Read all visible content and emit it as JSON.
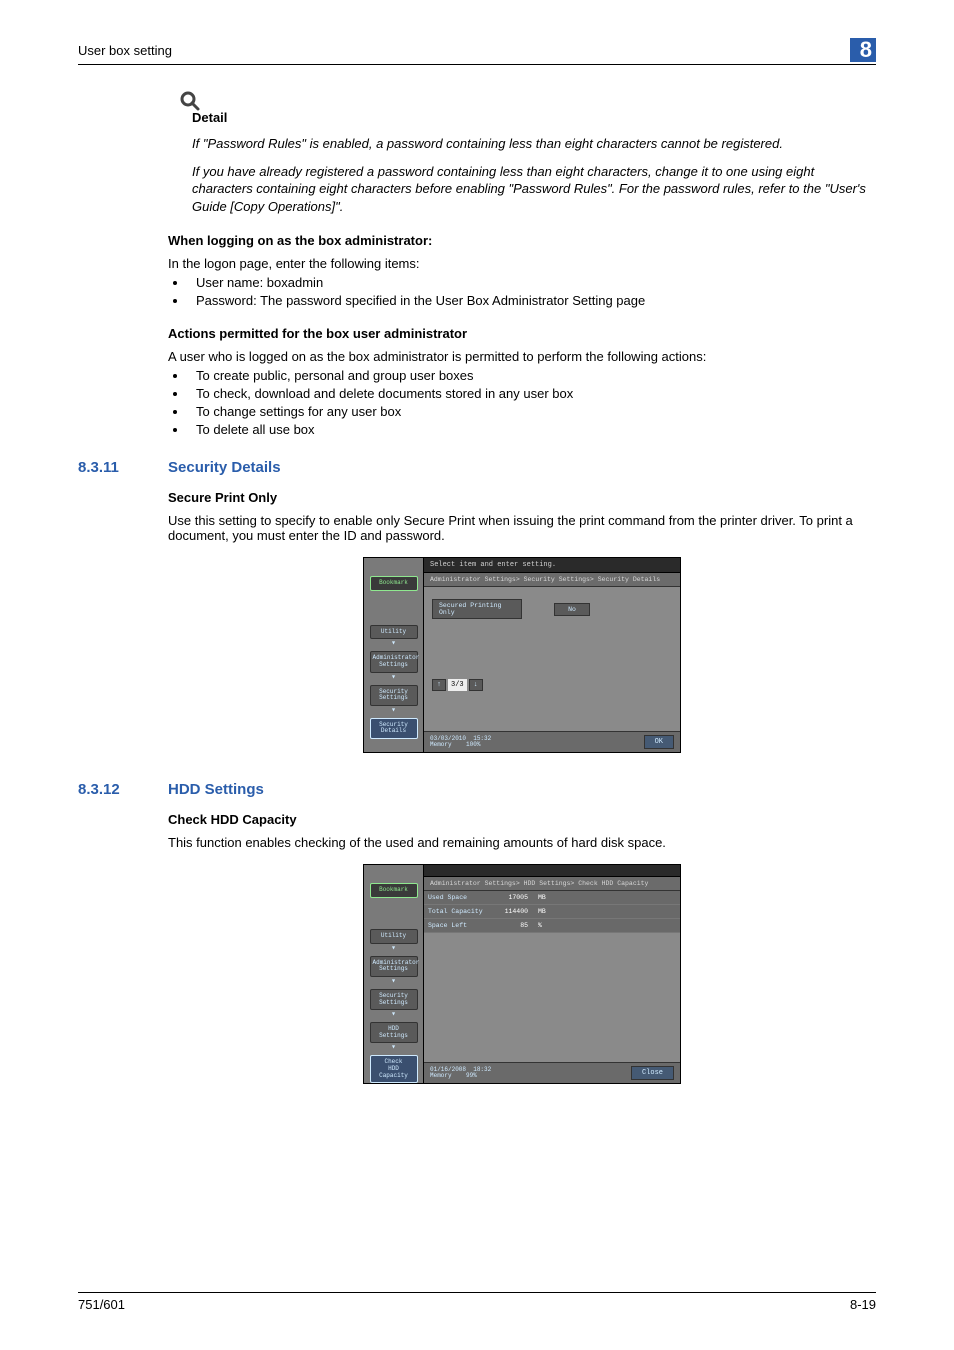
{
  "header": {
    "title": "User box setting",
    "chapter": "8"
  },
  "detail": {
    "label": "Detail",
    "p1": "If \"Password Rules\" is enabled, a password containing less than eight characters cannot be registered.",
    "p2": "If you have already registered a password containing less than eight characters, change it to one using eight characters containing eight characters before enabling \"Password Rules\". For the password rules, refer to the \"User's Guide [Copy Operations]\"."
  },
  "login": {
    "heading": "When logging on as the box administrator:",
    "intro": "In the logon page, enter the following items:",
    "items": [
      "User name: boxadmin",
      "Password: The password specified in the User Box Administrator Setting page"
    ]
  },
  "actions": {
    "heading": "Actions permitted for the box user administrator",
    "intro": "A user who is logged on as the box administrator is permitted to perform the following actions:",
    "items": [
      "To create public, personal and group user boxes",
      "To check, download and delete documents stored in any user box",
      "To change settings for any user box",
      "To delete all use box"
    ]
  },
  "sec_details": {
    "num": "8.3.11",
    "title": "Security Details",
    "sub": "Secure Print Only",
    "desc": "Use this setting to specify to enable only Secure Print when issuing the print command from the printer driver. To print a document, you must enter the ID and password."
  },
  "hdd": {
    "num": "8.3.12",
    "title": "HDD Settings",
    "sub": "Check HDD Capacity",
    "desc": "This function enables checking of the used and remaining amounts of hard disk space."
  },
  "shot1": {
    "bookmark": "Bookmark",
    "tabs": [
      "Utility",
      "Administrator Settings",
      "Security Settings",
      "Security Details"
    ],
    "topline": "Select item and enter setting.",
    "breadcrumb": "Administrator Settings> Security Settings> Security Details",
    "row_label": "Secured Printing Only",
    "row_value": "No",
    "pager": "3/3",
    "date": "03/03/2010",
    "time": "15:32",
    "mem1": "Memory",
    "mem2": "100%",
    "ok": "OK"
  },
  "shot2": {
    "bookmark": "Bookmark",
    "tabs": [
      "Utility",
      "Administrator Settings",
      "Security Settings",
      "HDD Settings",
      "Check\nHDD Capacity"
    ],
    "breadcrumb": "Administrator Settings> HDD Settings> Check HDD Capacity",
    "rows": [
      {
        "label": "Used Space",
        "value": "17005",
        "unit": "MB"
      },
      {
        "label": "Total Capacity",
        "value": "114400",
        "unit": "MB"
      },
      {
        "label": "Space Left",
        "value": "85",
        "unit": "%"
      }
    ],
    "date": "01/16/2008",
    "time": "18:32",
    "mem1": "Memory",
    "mem2": "99%",
    "close": "Close"
  },
  "footer": {
    "left": "751/601",
    "right": "8-19"
  }
}
